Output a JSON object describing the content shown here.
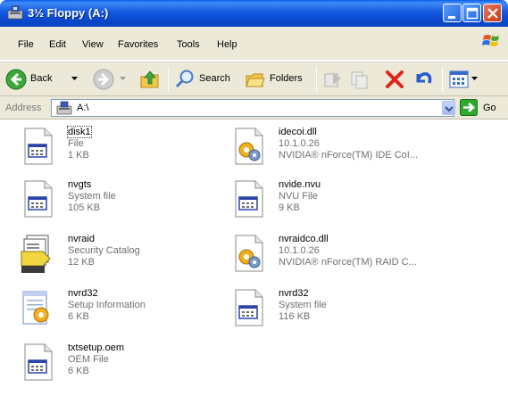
{
  "window": {
    "title": "3½ Floppy (A:)",
    "controls": [
      "minimize-icon",
      "maximize-icon",
      "close-icon"
    ]
  },
  "menu": {
    "items": [
      "File",
      "Edit",
      "View",
      "Favorites",
      "Tools",
      "Help"
    ]
  },
  "toolbar": {
    "back_label": "Back",
    "search_label": "Search",
    "folders_label": "Folders"
  },
  "address": {
    "label": "Address",
    "value": "A:\\",
    "go_label": "Go"
  },
  "files": [
    {
      "name": "disk1",
      "line1": "File",
      "line2": "1 KB",
      "icon": "generic-file-icon"
    },
    {
      "name": "idecoi.dll",
      "line1": "10.1.0.26",
      "line2": "NVIDIA® nForce(TM) IDE CoI...",
      "icon": "dll-file-icon"
    },
    {
      "name": "nvgts",
      "line1": "System file",
      "line2": "105 KB",
      "icon": "system-file-icon"
    },
    {
      "name": "nvide.nvu",
      "line1": "NVU File",
      "line2": "9 KB",
      "icon": "generic-file-icon"
    },
    {
      "name": "nvraid",
      "line1": "Security Catalog",
      "line2": "12 KB",
      "icon": "security-catalog-icon"
    },
    {
      "name": "nvraidco.dll",
      "line1": "10.1.0.26",
      "line2": "NVIDIA® nForce(TM) RAID C...",
      "icon": "dll-file-icon"
    },
    {
      "name": "nvrd32",
      "line1": "Setup Information",
      "line2": "6 KB",
      "icon": "setup-information-icon"
    },
    {
      "name": "nvrd32",
      "line1": "System file",
      "line2": "116 KB",
      "icon": "system-file-icon"
    },
    {
      "name": "txtsetup.oem",
      "line1": "OEM File",
      "line2": "6 KB",
      "icon": "generic-file-icon"
    }
  ]
}
